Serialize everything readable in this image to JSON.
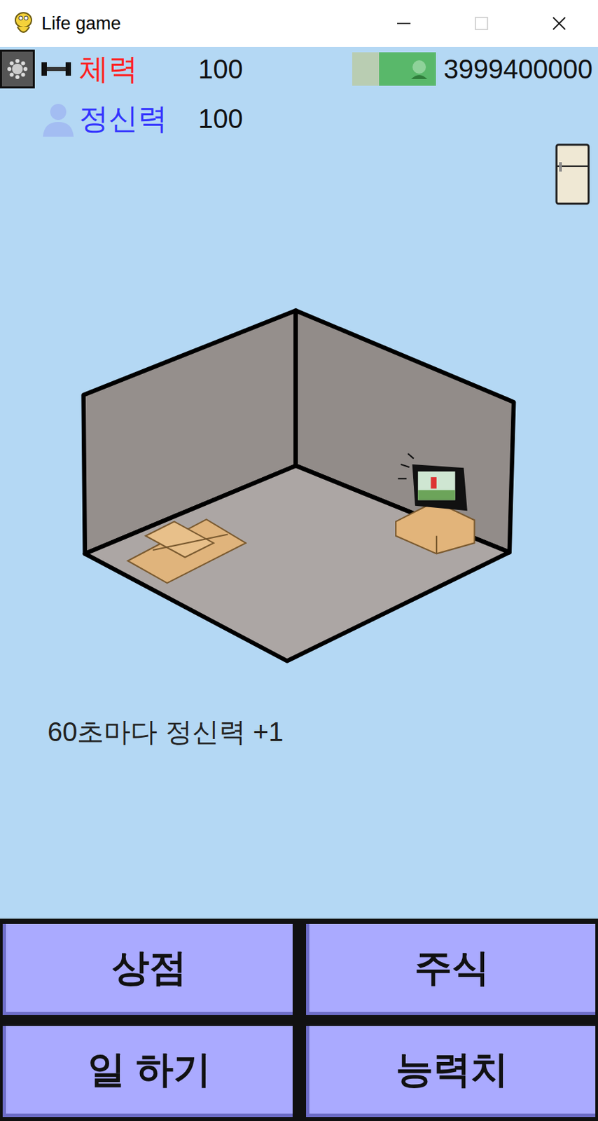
{
  "window": {
    "title": "Life game",
    "maximizable": false
  },
  "stats": [
    {
      "kind": "strength",
      "label": "체력",
      "value": "100",
      "color": "#ff1f1f"
    },
    {
      "kind": "mind",
      "label": "정신력",
      "value": "100",
      "color": "#3333ff"
    }
  ],
  "money": {
    "amount": "3999400000"
  },
  "info": "60초마다 정신력 +1",
  "buttons": [
    "상점",
    "주식",
    "일 하기",
    "능력치"
  ]
}
